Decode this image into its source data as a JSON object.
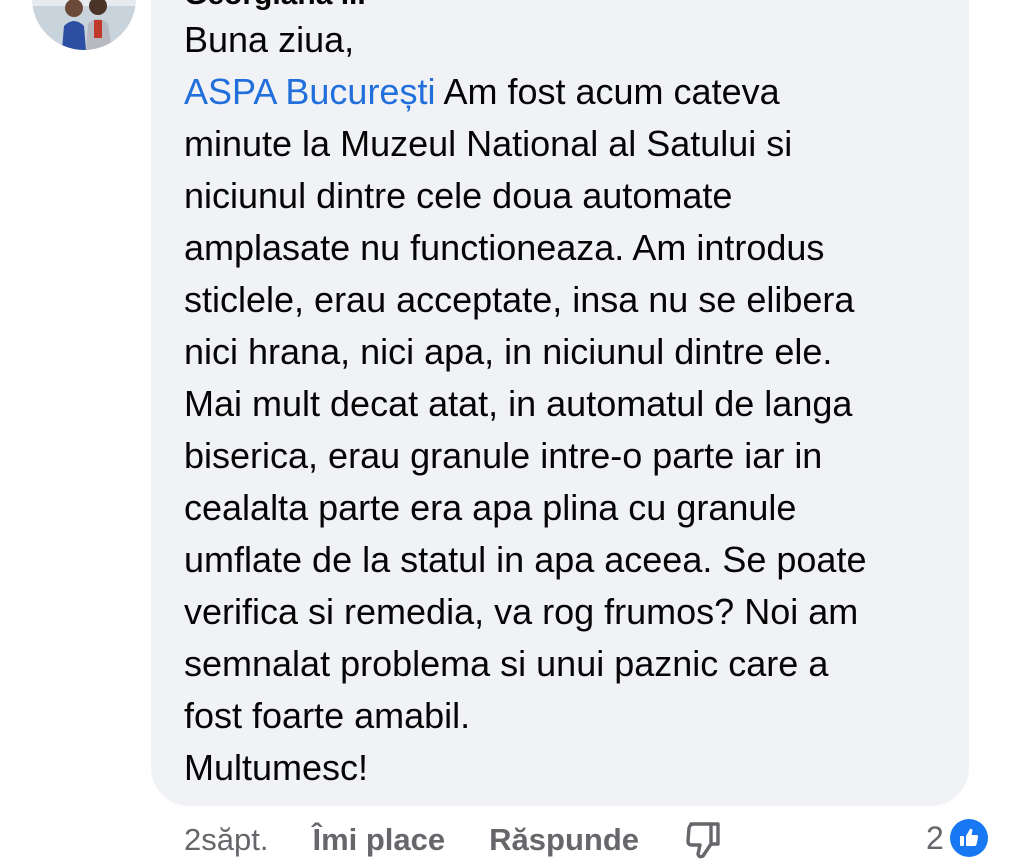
{
  "comment": {
    "author_name": "Georgiana ...",
    "text_lines": [
      "Buna ziua,",
      "Am fost acum cateva",
      "minute la Muzeul National al Satului si",
      "niciunul dintre cele doua automate",
      "amplasate nu functioneaza. Am introdus",
      "sticlele, erau acceptate, insa nu se elibera",
      "nici hrana, nici apa, in niciunul dintre ele.",
      "Mai mult decat atat, in automatul de langa",
      "biserica, erau granule intre-o parte iar in",
      "cealalta parte era apa plina cu granule",
      "umflate de la statul in apa aceea. Se poate",
      "verifica si remedia, va rog frumos? Noi am",
      "semnalat problema si unui paznic care a",
      "fost foarte amabil.",
      "Multumesc!"
    ],
    "mention": "ASPA București"
  },
  "actions": {
    "time": "2săpt.",
    "like_label": "Îmi place",
    "reply_label": "Răspunde"
  },
  "reactions": {
    "count": "2",
    "icon": "like-thumb-icon"
  },
  "colors": {
    "bubble": "#f0f2f5",
    "text": "#050505",
    "mention": "#216fdb",
    "secondary": "#65676b",
    "like_blue": "#1877f2"
  }
}
